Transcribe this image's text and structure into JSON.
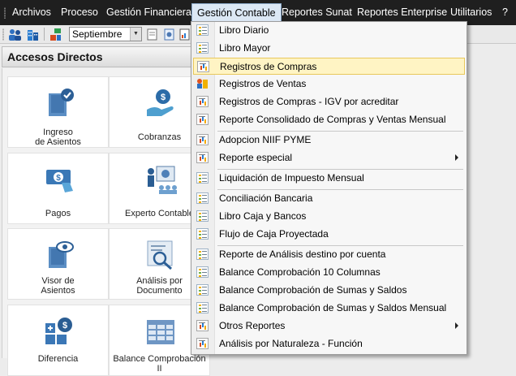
{
  "menubar": {
    "items": [
      "Archivos",
      "Proceso",
      "Gestión Financiera",
      "Gestión Contable",
      "Reportes Sunat",
      "Reportes Enterprise",
      "Utilitarios",
      "?"
    ],
    "active": "Gestión Contable"
  },
  "toolbar": {
    "period_select": "Septiembre"
  },
  "panel": {
    "title": "Accesos Directos",
    "tiles": [
      {
        "label": "Ingreso\nde Asientos",
        "icon": "ledger-check-icon"
      },
      {
        "label": "Cobranzas",
        "icon": "hand-money-icon"
      },
      {
        "label": "Pagos",
        "icon": "bill-payment-icon"
      },
      {
        "label": "Experto Contable",
        "icon": "expert-presenter-icon"
      },
      {
        "label": "Visor de\nAsientos",
        "icon": "ledger-eye-icon"
      },
      {
        "label": "Análisis por\nDocumento",
        "icon": "document-analysis-icon"
      },
      {
        "label": "Diferencia",
        "icon": "calculator-money-icon"
      },
      {
        "label": "Balance Comprobación II",
        "icon": "spreadsheet-icon"
      }
    ]
  },
  "dropdown": {
    "items": [
      {
        "label": "Libro Diario",
        "icon": "list-icon"
      },
      {
        "label": "Libro Mayor",
        "icon": "list-icon"
      },
      {
        "label": "Registros de Compras",
        "icon": "report-icon",
        "highlighted": true
      },
      {
        "label": "Registros de Ventas",
        "icon": "sales-report-icon"
      },
      {
        "label": "Registros de Compras - IGV por acreditar",
        "icon": "report-icon"
      },
      {
        "label": "Reporte Consolidado de Compras y Ventas Mensual",
        "icon": "report-icon"
      },
      {
        "label": "Adopcion NIIF PYME",
        "icon": "report-icon"
      },
      {
        "label": "Reporte especial",
        "icon": "report-icon",
        "submenu": true
      },
      {
        "label": "Liquidación de Impuesto Mensual",
        "icon": "list-icon"
      },
      {
        "label": "Conciliación Bancaria",
        "icon": "list-icon"
      },
      {
        "label": "Libro Caja y Bancos",
        "icon": "list-icon"
      },
      {
        "label": "Flujo de Caja Proyectada",
        "icon": "list-icon"
      },
      {
        "label": "Reporte de Análisis destino por cuenta",
        "icon": "list-icon"
      },
      {
        "label": "Balance Comprobación 10 Columnas",
        "icon": "list-icon"
      },
      {
        "label": "Balance Comprobación de Sumas y Saldos",
        "icon": "list-icon"
      },
      {
        "label": "Balance Comprobación de Sumas y Saldos Mensual",
        "icon": "list-icon"
      },
      {
        "label": "Otros Reportes",
        "icon": "report-icon",
        "submenu": true
      },
      {
        "label": "Análisis por Naturaleza - Función",
        "icon": "report-icon"
      }
    ]
  }
}
